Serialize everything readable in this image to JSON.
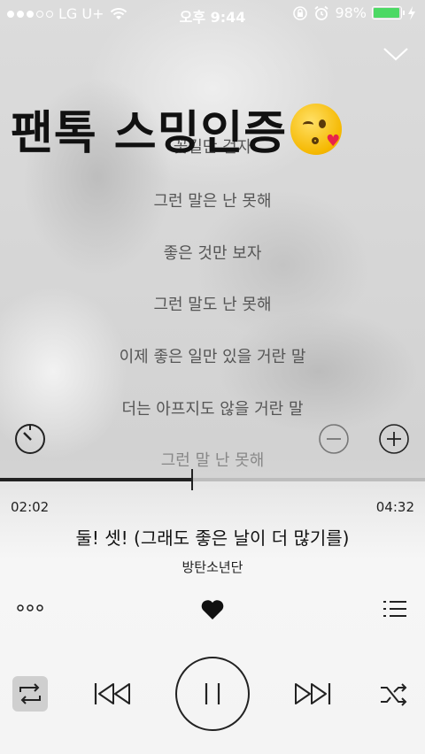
{
  "status_bar": {
    "carrier": "LG U+",
    "time": "오후 9:44",
    "battery": "98%",
    "battery_level": 0.98
  },
  "overlay_text": "팬톡 스밍인증",
  "lyrics": [
    "꽃길만 걷자",
    "그런 말은 난 못해",
    "좋은 것만 보자",
    "그런 말도 난 못해",
    "이제 좋은 일만 있을 거란 말",
    "더는 아프지도 않을 거란 말",
    "그런 말 난 못해"
  ],
  "player": {
    "elapsed": "02:02",
    "duration": "04:32",
    "progress": 0.449,
    "song_title": "둘! 셋! (그래도 좋은 날이 더 많기를)",
    "artist": "방탄소년단"
  },
  "colors": {
    "battery_fill": "#4cd964",
    "accent": "#222222"
  }
}
